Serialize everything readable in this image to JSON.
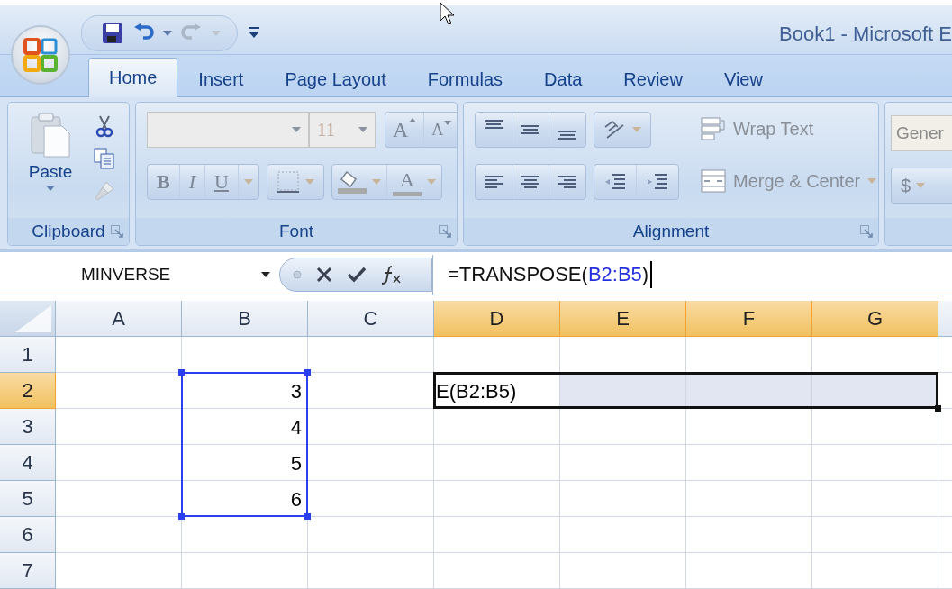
{
  "title_bar": {
    "title": "Book1 - Microsoft E"
  },
  "tabs": [
    {
      "label": "Home",
      "selected": true
    },
    {
      "label": "Insert",
      "selected": false
    },
    {
      "label": "Page Layout",
      "selected": false
    },
    {
      "label": "Formulas",
      "selected": false
    },
    {
      "label": "Data",
      "selected": false
    },
    {
      "label": "Review",
      "selected": false
    },
    {
      "label": "View",
      "selected": false
    }
  ],
  "ribbon": {
    "clipboard": {
      "paste_label": "Paste",
      "group_label": "Clipboard"
    },
    "font": {
      "font_size": "11",
      "size_buttons": [
        "A",
        "A"
      ],
      "style_buttons": [
        "B",
        "I",
        "U"
      ],
      "font_color_label": "A",
      "group_label": "Font"
    },
    "alignment": {
      "wrap_text": "Wrap Text",
      "merge_center": "Merge & Center",
      "group_label": "Alignment"
    },
    "number": {
      "format": "Gener",
      "currency": "$"
    }
  },
  "formula_bar": {
    "name_box": "MINVERSE",
    "formula": [
      {
        "text": "=TRANSPOSE(",
        "kind": "plain"
      },
      {
        "text": "B2:B5",
        "kind": "reference"
      },
      {
        "text": ")",
        "kind": "plain"
      }
    ]
  },
  "sheet": {
    "columns": [
      {
        "label": "A",
        "selected": false
      },
      {
        "label": "B",
        "selected": false
      },
      {
        "label": "C",
        "selected": false
      },
      {
        "label": "D",
        "selected": true
      },
      {
        "label": "E",
        "selected": true
      },
      {
        "label": "F",
        "selected": true
      },
      {
        "label": "G",
        "selected": true
      }
    ],
    "rows": [
      {
        "label": "1",
        "selected": false
      },
      {
        "label": "2",
        "selected": true,
        "cells": [
          {
            "kind": "empty"
          },
          {
            "kind": "reference",
            "text": "3"
          },
          {
            "kind": "empty"
          },
          {
            "kind": "editing",
            "text": "E(B2:B5)"
          },
          {
            "kind": "selected"
          },
          {
            "kind": "selected"
          },
          {
            "kind": "selected"
          }
        ]
      },
      {
        "label": "3",
        "selected": false,
        "cells": [
          {
            "kind": "empty"
          },
          {
            "kind": "reference",
            "text": "4"
          },
          {
            "kind": "empty"
          },
          {
            "kind": "empty"
          },
          {
            "kind": "empty"
          },
          {
            "kind": "empty"
          },
          {
            "kind": "empty"
          }
        ]
      },
      {
        "label": "4",
        "selected": false,
        "cells": [
          {
            "kind": "empty"
          },
          {
            "kind": "reference",
            "text": "5"
          },
          {
            "kind": "empty"
          },
          {
            "kind": "empty"
          },
          {
            "kind": "empty"
          },
          {
            "kind": "empty"
          },
          {
            "kind": "empty"
          }
        ]
      },
      {
        "label": "5",
        "selected": false,
        "cells": [
          {
            "kind": "empty"
          },
          {
            "kind": "reference",
            "text": "6"
          },
          {
            "kind": "empty"
          },
          {
            "kind": "empty"
          },
          {
            "kind": "empty"
          },
          {
            "kind": "empty"
          },
          {
            "kind": "empty"
          }
        ]
      },
      {
        "label": "6",
        "selected": false
      },
      {
        "label": "7",
        "selected": false
      }
    ]
  }
}
